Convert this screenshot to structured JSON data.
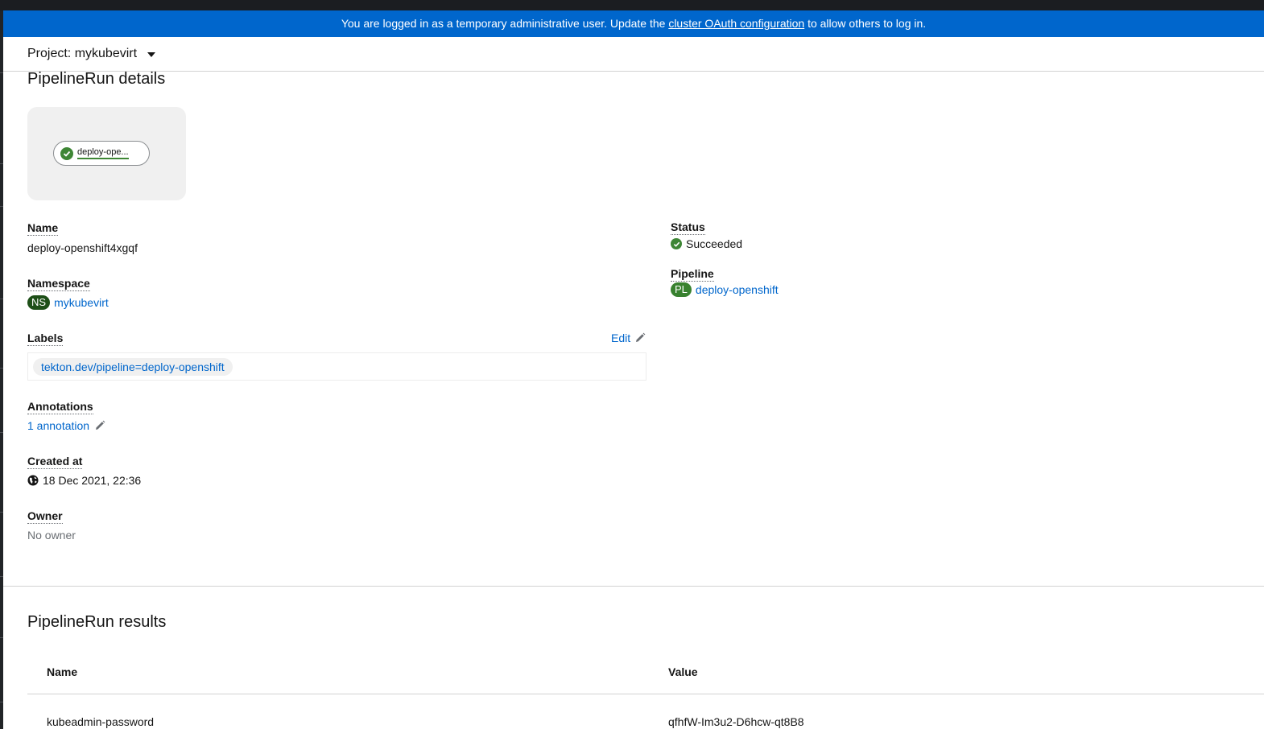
{
  "banner": {
    "text_before": "You are logged in as a temporary administrative user. Update the",
    "link": "cluster OAuth configuration",
    "text_after": "to allow others to log in."
  },
  "project": {
    "label": "Project: mykubevirt"
  },
  "details": {
    "title": "PipelineRun details",
    "graph_node": {
      "label": "deploy-ope...",
      "status": "succeeded"
    },
    "name": {
      "term": "Name",
      "value": "deploy-openshift4xgqf"
    },
    "namespace": {
      "term": "Namespace",
      "badge": "NS",
      "value": "mykubevirt"
    },
    "labels": {
      "term": "Labels",
      "edit": "Edit",
      "items": [
        "tekton.dev/pipeline=deploy-openshift"
      ]
    },
    "annotations": {
      "term": "Annotations",
      "value": "1 annotation"
    },
    "created_at": {
      "term": "Created at",
      "value": "18 Dec 2021, 22:36"
    },
    "owner": {
      "term": "Owner",
      "value": "No owner"
    },
    "status": {
      "term": "Status",
      "value": "Succeeded"
    },
    "pipeline": {
      "term": "Pipeline",
      "badge": "PL",
      "value": "deploy-openshift"
    }
  },
  "results": {
    "title": "PipelineRun results",
    "columns": [
      "Name",
      "Value"
    ],
    "rows": [
      {
        "name": "kubeadmin-password",
        "value": "qfhfW-Im3u2-D6hcw-qt8B8"
      }
    ]
  },
  "colors": {
    "banner": "#0066cc",
    "link": "#0066cc",
    "success": "#3e8635",
    "ns_badge": "#1e4f18",
    "pl_badge": "#38812f"
  }
}
